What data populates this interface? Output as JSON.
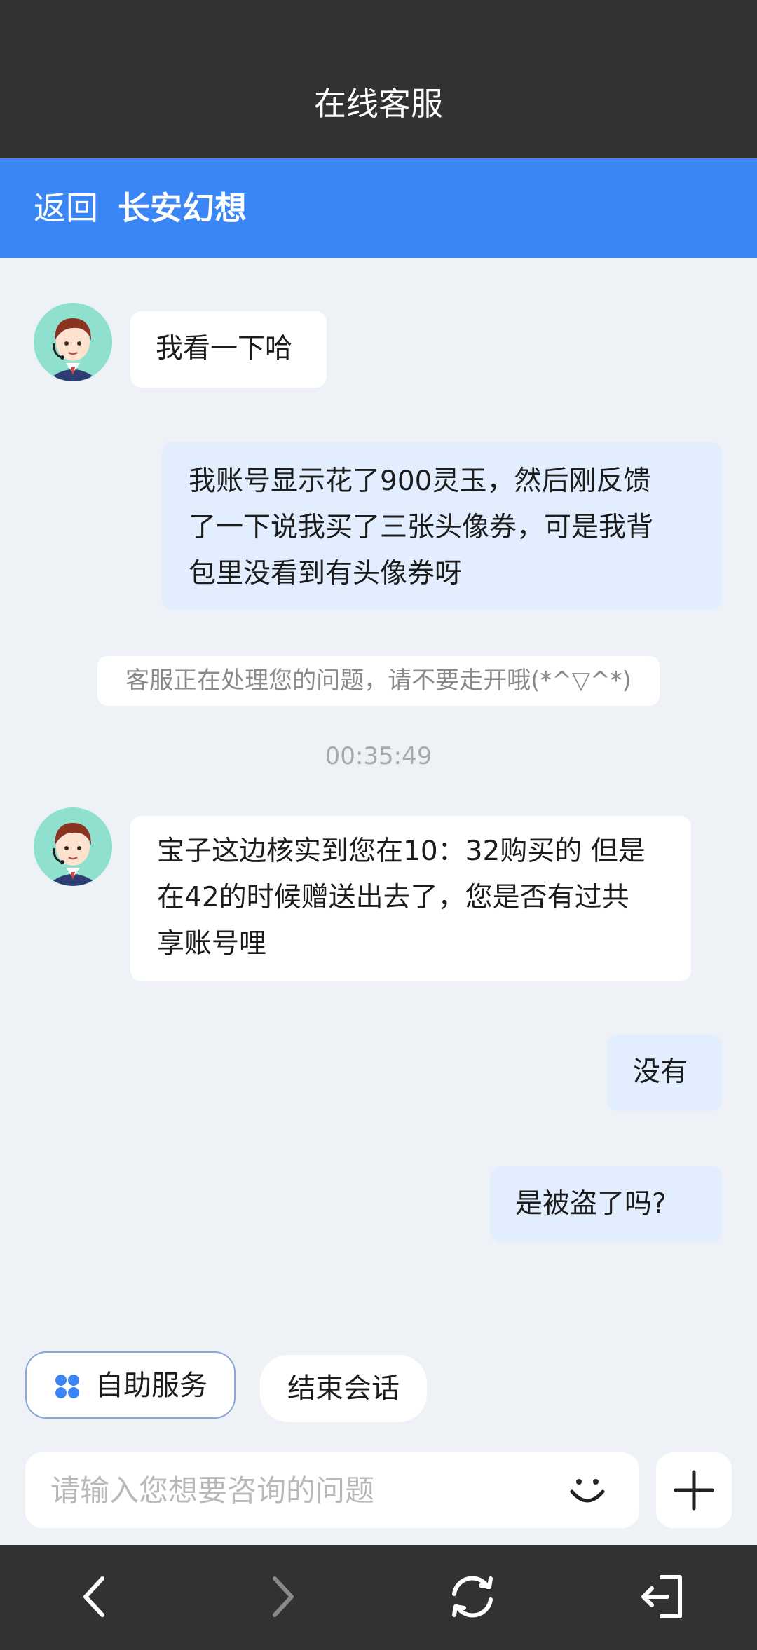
{
  "header": {
    "title": "在线客服"
  },
  "nav": {
    "back_label": "返回",
    "game_title": "长安幻想"
  },
  "chat": {
    "messages": [
      {
        "role": "agent",
        "text": "我看一下哈"
      },
      {
        "role": "user",
        "lines": [
          "我账号显示花了900灵玉，然后刚反馈",
          "了一下说我买了三张头像券，可是我背",
          "包里没看到有头像券呀"
        ]
      },
      {
        "role": "system",
        "text": "客服正在处理您的问题，请不要走开哦(*^▽^*)"
      },
      {
        "role": "timestamp",
        "text": "00:35:49"
      },
      {
        "role": "agent",
        "lines": [
          "宝子这边核实到您在10：32购买的 但是",
          "在42的时候赠送出去了，您是否有过共",
          "享账号哩"
        ]
      },
      {
        "role": "user",
        "text": "没有"
      },
      {
        "role": "user",
        "text": "是被盗了吗?"
      }
    ]
  },
  "quick_actions": {
    "self_service_label": "自助服务",
    "end_session_label": "结束会话"
  },
  "input": {
    "placeholder": "请输入您想要咨询的问题",
    "value": ""
  },
  "icons": {
    "self_service": "four-dots-icon",
    "emoji": "smiley-icon",
    "plus": "plus-icon",
    "back": "chevron-left-icon",
    "forward": "chevron-right-icon",
    "refresh": "refresh-icon",
    "exit": "exit-icon"
  },
  "colors": {
    "accent": "#3a86f6",
    "dark_bar": "#323232",
    "user_bubble": "#e2eefe",
    "chat_bg": "#eef1f5"
  }
}
